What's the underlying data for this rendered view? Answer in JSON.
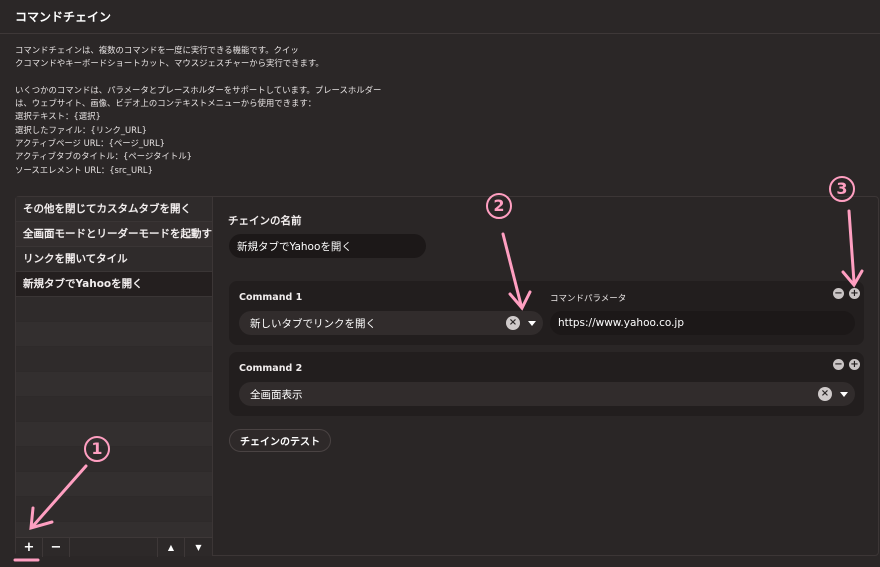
{
  "header": {
    "title": "コマンドチェイン"
  },
  "description": {
    "lines": [
      "コマンドチェインは、複数のコマンドを一度に実行できる機能です。クイッ",
      "クコマンドやキーボードショートカット、マウスジェスチャーから実行できます。",
      "",
      "いくつかのコマンドは、パラメータとプレースホルダーをサポートしています。プレースホルダー",
      "は、ウェブサイト、画像、ビデオ上のコンテキストメニューから使用できます：",
      "選択テキスト：{選択}",
      "選択したファイル：{リンク_URL}",
      "アクティブページ URL：{ページ_URL}",
      "アクティブタブのタイトル：{ページタイトル}",
      "ソースエレメント URL：{src_URL}"
    ]
  },
  "chain_list": {
    "items": [
      {
        "label": "その他を閉じてカスタムタブを開く"
      },
      {
        "label": "全画面モードとリーダーモードを起動する"
      },
      {
        "label": "リンクを開いてタイル"
      },
      {
        "label": "新規タブでYahooを開く"
      }
    ],
    "toolbar": {
      "add": "+",
      "remove": "−",
      "up": "▲",
      "down": "▼"
    }
  },
  "editor": {
    "name_label": "チェインの名前",
    "name_value": "新規タブでYahooを開く",
    "commands": [
      {
        "label": "Command 1",
        "selected": "新しいタブでリンクを開く",
        "param_label": "コマンドパラメータ",
        "param_value": "https://www.yahoo.co.jp"
      },
      {
        "label": "Command 2",
        "selected": "全画面表示"
      }
    ],
    "test_button": "チェインのテスト",
    "clear_glyph": "×",
    "minus_glyph": "−",
    "plus_glyph": "+"
  },
  "annotations": {
    "one": "1",
    "two": "2",
    "three": "3",
    "color": "#ff9fc1"
  }
}
